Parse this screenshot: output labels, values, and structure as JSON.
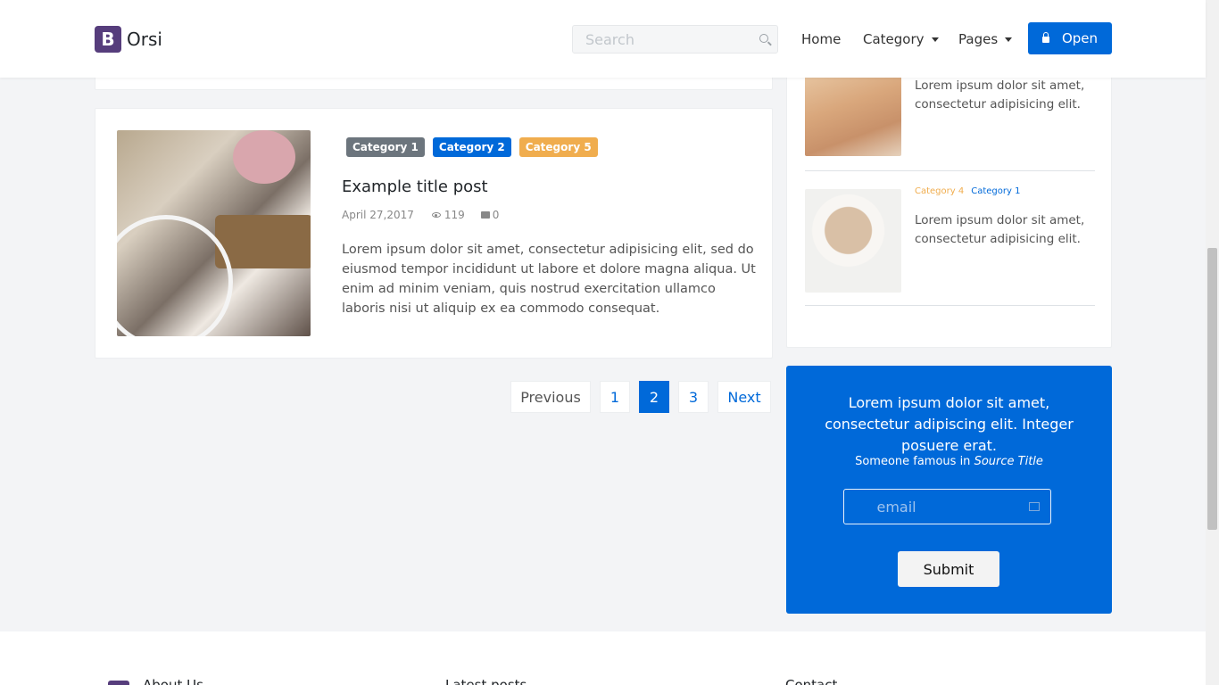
{
  "brand": {
    "logo_letter": "B",
    "name": "Orsi"
  },
  "search": {
    "placeholder": "Search",
    "icon": "search-icon"
  },
  "nav": {
    "home": "Home",
    "category": "Category",
    "pages": "Pages",
    "open_button": "Open"
  },
  "post": {
    "categories": [
      "Category 1",
      "Category 2",
      "Category 5"
    ],
    "category_colors": [
      "#6c757d",
      "#0069d9",
      "#f0ad4e"
    ],
    "title": "Example title post",
    "date": "April 27,2017",
    "views": "119",
    "comments": "0",
    "excerpt": "Lorem ipsum dolor sit amet, consectetur adipisicing elit, sed do eiusmod tempor incididunt ut labore et dolore magna aliqua. Ut enim ad minim veniam, quis nostrud exercitation ullamco laboris nisi ut aliquip ex ea commodo consequat."
  },
  "pagination": {
    "previous": "Previous",
    "pages": [
      "1",
      "2",
      "3"
    ],
    "active": "2",
    "next": "Next"
  },
  "sidebar": {
    "items": [
      {
        "text": "Lorem ipsum dolor sit amet, consectetur adipisicing elit."
      },
      {
        "cat_a": "Category 4",
        "cat_b": "Category 1",
        "text": "Lorem ipsum dolor sit amet, consectetur adipisicing elit."
      }
    ]
  },
  "quote": {
    "text": "Lorem ipsum dolor sit amet, consectetur adipiscing elit. Integer posuere erat.",
    "source_prefix": "Someone famous in",
    "source_title": "Source Title",
    "email_placeholder": "email",
    "submit": "Submit"
  },
  "footer": {
    "headings": [
      "About Us",
      "Latest posts",
      "Contact"
    ]
  },
  "colors": {
    "primary": "#0069d9",
    "brand": "#563d7c",
    "orange": "#f0ad4e",
    "gray": "#6c757d"
  }
}
